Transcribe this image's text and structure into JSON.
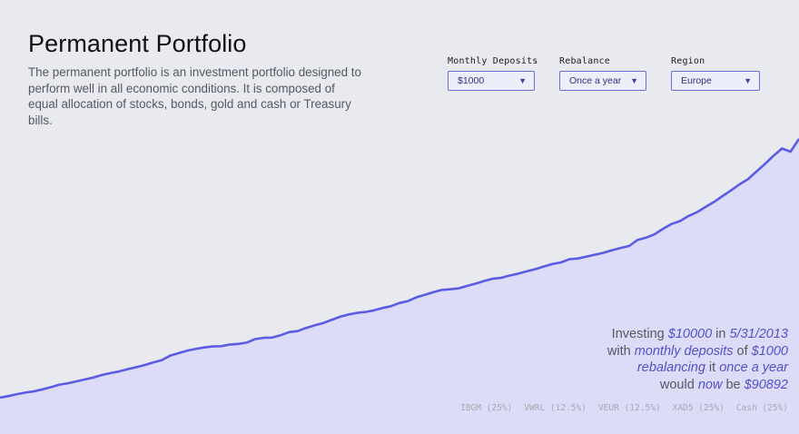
{
  "header": {
    "title": "Permanent Portfolio",
    "description": "The permanent portfolio is an investment portfolio designed to perform well in all economic conditions. It is composed of equal allocation of stocks, bonds, gold and cash or Treasury bills."
  },
  "controls": {
    "monthly_deposits": {
      "label": "Monthly Deposits",
      "value": "$1000"
    },
    "rebalance": {
      "label": "Rebalance",
      "value": "Once a year"
    },
    "region": {
      "label": "Region",
      "value": "Europe"
    },
    "dropdown_icon": "caret-down-icon"
  },
  "summary": {
    "p1": "Investing ",
    "initial": "$10000",
    "p2": " in ",
    "date": "5/31/2013",
    "p3": "with ",
    "deposits_phrase": "monthly deposits",
    "p4": " of ",
    "deposit": "$1000",
    "rebalancing_phrase": "rebalancing",
    "p5": " it ",
    "frequency": "once a year",
    "p6": "would ",
    "now_word": "now",
    "p7": " be ",
    "final": "$90892"
  },
  "allocation": [
    {
      "label": "IBGM (25%)"
    },
    {
      "label": "VWRL (12.5%)"
    },
    {
      "label": "VEUR (12.5%)"
    },
    {
      "label": "XAD5 (25%)"
    },
    {
      "label": "Cash (25%)"
    }
  ],
  "colors": {
    "background": "#e9eaf0",
    "line": "#5b5ce2",
    "area": "#dcdcf8",
    "accent": "#5152c8"
  },
  "chart_data": {
    "type": "area",
    "series": [
      {
        "values": [
          10000,
          10500,
          11100,
          11600,
          12000,
          12600,
          13300,
          14100,
          14500,
          15100,
          15700,
          16300,
          17100,
          17700,
          18200,
          18900,
          19500,
          20200,
          21000,
          21700,
          23100,
          23900,
          24700,
          25200,
          25700,
          26000,
          26100,
          26600,
          26800,
          27200,
          28300,
          28700,
          28800,
          29500,
          30500,
          30800,
          31800,
          32600,
          33300,
          34300,
          35300,
          36000,
          36500,
          36800,
          37300,
          38000,
          38600,
          39600,
          40200,
          41400,
          42200,
          43000,
          43700,
          43900,
          44200,
          45000,
          45700,
          46500,
          47200,
          47500,
          48200,
          48800,
          49500,
          50200,
          51000,
          51800,
          52300,
          53300,
          53500,
          54100,
          54700,
          55300,
          56100,
          56800,
          57400,
          59300,
          60000,
          61100,
          62800,
          64300,
          65200,
          66800,
          68000,
          69600,
          71200,
          73000,
          74800,
          76700,
          78300,
          80700,
          83100,
          85600,
          87900,
          86900,
          90892
        ]
      }
    ]
  }
}
